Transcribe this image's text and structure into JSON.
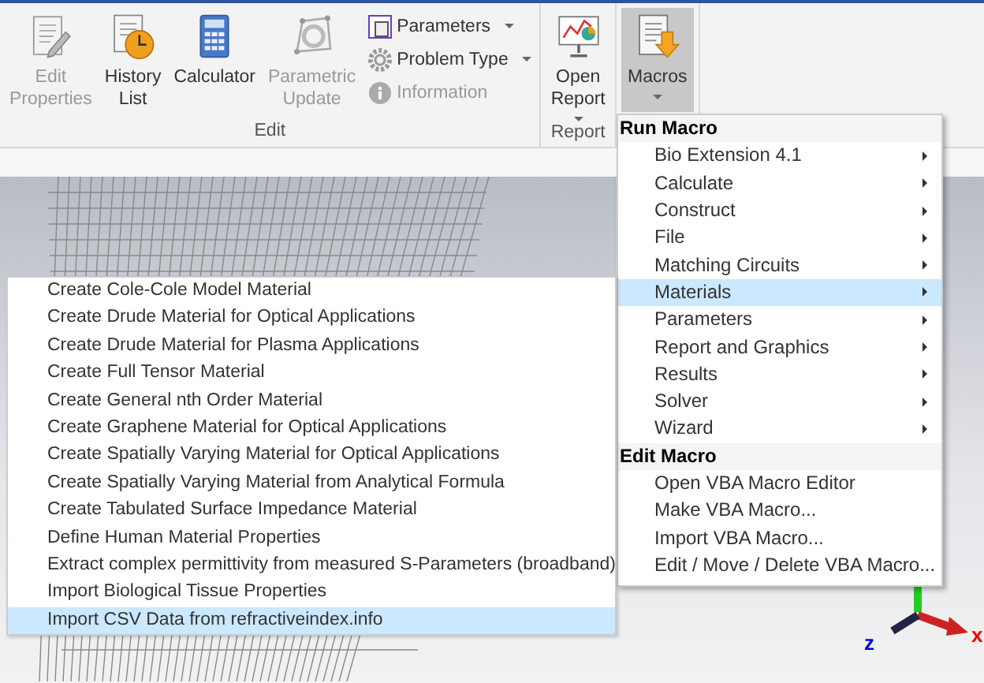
{
  "ribbon": {
    "groups": [
      {
        "label": "Edit",
        "large_buttons": [
          {
            "label": "Edit Properties",
            "disabled": true
          },
          {
            "label": "History List",
            "disabled": false
          },
          {
            "label": "Calculator",
            "disabled": false
          },
          {
            "label": "Parametric Update",
            "disabled": true
          }
        ],
        "small_buttons": [
          {
            "label": "Parameters",
            "dropdown": true,
            "disabled": false
          },
          {
            "label": "Problem Type",
            "dropdown": true,
            "disabled": false
          },
          {
            "label": "Information",
            "dropdown": false,
            "disabled": true
          }
        ]
      },
      {
        "label": "Report",
        "large_buttons": [
          {
            "label": "Open Report",
            "dropdown": true,
            "disabled": false
          }
        ]
      },
      {
        "large_buttons": [
          {
            "label": "Macros",
            "dropdown": true,
            "disabled": false,
            "pressed": true
          }
        ]
      }
    ]
  },
  "macro_menu": [
    {
      "kind": "header",
      "label": "Run Macro"
    },
    {
      "kind": "item",
      "label": "Bio Extension 4.1",
      "submenu": true,
      "selected": false
    },
    {
      "kind": "item",
      "label": "Calculate",
      "submenu": true,
      "selected": false
    },
    {
      "kind": "item",
      "label": "Construct",
      "submenu": true,
      "selected": false
    },
    {
      "kind": "item",
      "label": "File",
      "submenu": true,
      "selected": false
    },
    {
      "kind": "item",
      "label": "Matching Circuits",
      "submenu": true,
      "selected": false
    },
    {
      "kind": "item",
      "label": "Materials",
      "submenu": true,
      "selected": true
    },
    {
      "kind": "item",
      "label": "Parameters",
      "submenu": true,
      "selected": false
    },
    {
      "kind": "item",
      "label": "Report and Graphics",
      "submenu": true,
      "selected": false
    },
    {
      "kind": "item",
      "label": "Results",
      "submenu": true,
      "selected": false
    },
    {
      "kind": "item",
      "label": "Solver",
      "submenu": true,
      "selected": false
    },
    {
      "kind": "item",
      "label": "Wizard",
      "submenu": true,
      "selected": false
    },
    {
      "kind": "header",
      "label": "Edit Macro"
    },
    {
      "kind": "item",
      "label": "Open VBA Macro Editor",
      "submenu": false,
      "selected": false
    },
    {
      "kind": "item",
      "label": "Make VBA Macro...",
      "submenu": false,
      "selected": false
    },
    {
      "kind": "item",
      "label": "Import VBA Macro...",
      "submenu": false,
      "selected": false
    },
    {
      "kind": "item",
      "label": "Edit / Move / Delete VBA Macro...",
      "submenu": false,
      "selected": false
    }
  ],
  "materials_submenu": [
    {
      "label": "Create Cole-Cole Model Material",
      "selected": false
    },
    {
      "label": "Create Drude Material for Optical Applications",
      "selected": false
    },
    {
      "label": "Create Drude Material for Plasma Applications",
      "selected": false
    },
    {
      "label": "Create Full Tensor Material",
      "selected": false
    },
    {
      "label": "Create General nth Order Material",
      "selected": false
    },
    {
      "label": "Create Graphene Material for Optical Applications",
      "selected": false
    },
    {
      "label": "Create Spatially Varying Material for Optical Applications",
      "selected": false
    },
    {
      "label": "Create Spatially Varying Material from Analytical Formula",
      "selected": false
    },
    {
      "label": "Create Tabulated Surface Impedance Material",
      "selected": false
    },
    {
      "label": "Define Human Material Properties",
      "selected": false
    },
    {
      "label": "Extract complex permittivity from measured S-Parameters (broadband)",
      "selected": false
    },
    {
      "label": "Import Biological Tissue Properties",
      "selected": false
    },
    {
      "label": "Import CSV Data from refractiveindex.info",
      "selected": true
    }
  ],
  "axes": {
    "x_label": "x",
    "z_label": "z"
  }
}
